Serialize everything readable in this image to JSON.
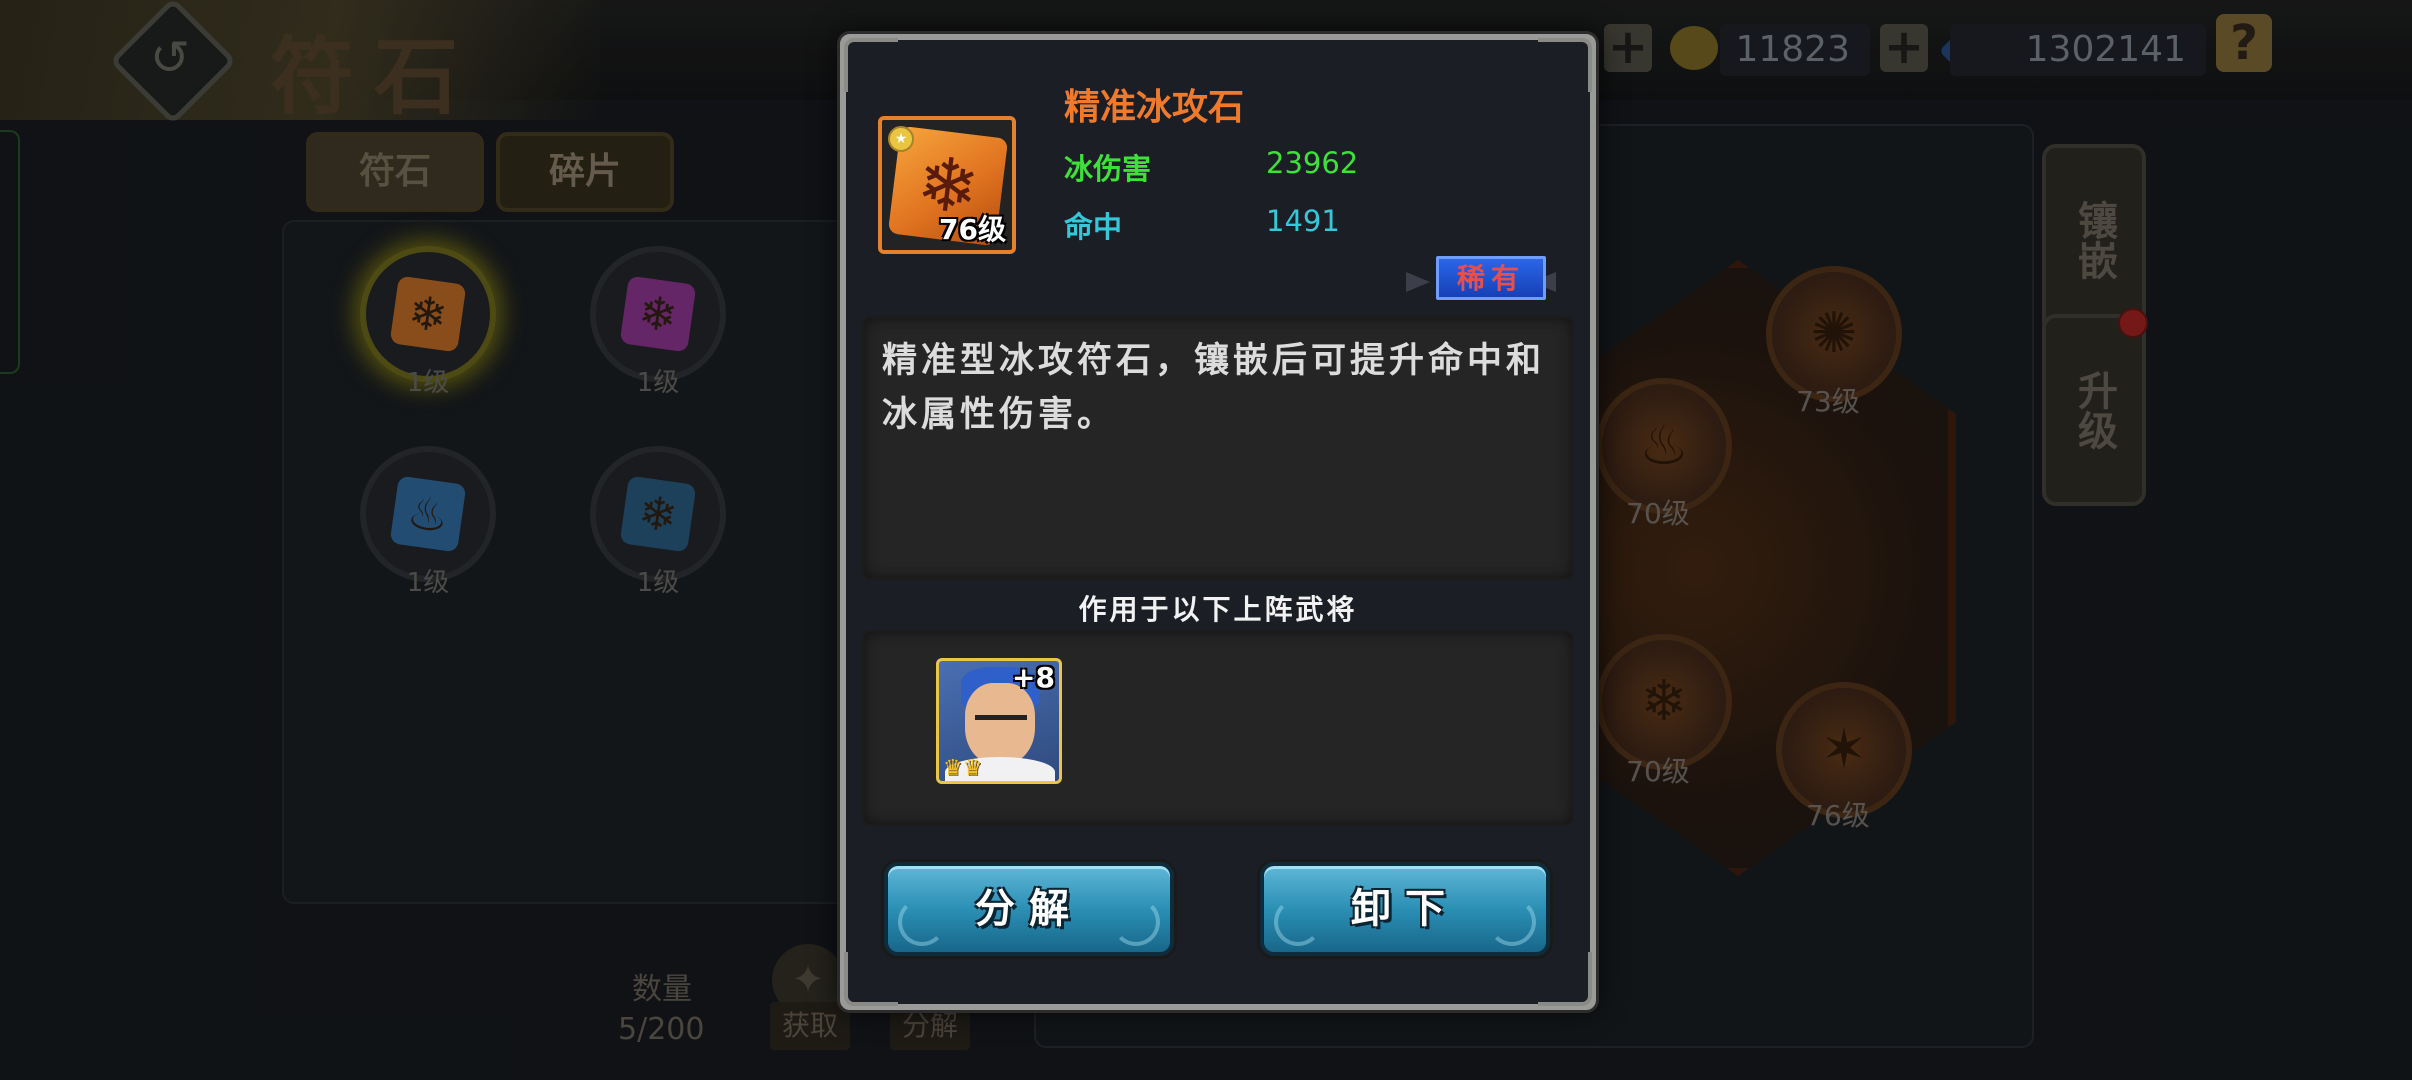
{
  "background": {
    "page_title": "符石",
    "resources": [
      {
        "name": "gold",
        "value": "11823"
      },
      {
        "name": "gem",
        "value": "1302141"
      }
    ],
    "help_label": "?",
    "tabs": [
      {
        "label": "符石",
        "active": true
      },
      {
        "label": "碎片",
        "active": false
      }
    ],
    "inventory": [
      {
        "level": "1级",
        "color": "#c8742a",
        "icon": "snowflake-icon"
      },
      {
        "level": "1级",
        "color": "#9a3d9c",
        "icon": "snowflake-icon"
      },
      {
        "level": "1级",
        "color": "#2f6fa8",
        "icon": "flame-icon"
      },
      {
        "level": "1级",
        "color": "#2a5f8e",
        "icon": "snowflake-icon"
      }
    ],
    "quantity_label": "数量",
    "quantity_value": "5/200",
    "acquire_label": "获取",
    "decompose_label": "分解",
    "socket_levels": [
      "73级",
      "70级",
      "70级",
      "76级"
    ],
    "side_buttons": [
      {
        "label": "镶嵌"
      },
      {
        "label": "升级"
      }
    ]
  },
  "modal": {
    "item": {
      "name": "精准冰攻石",
      "level": "76级",
      "icon": "snowflake-icon",
      "frame_color": "#e5812c"
    },
    "stats": [
      {
        "label": "冰伤害",
        "value": "23962",
        "color": "#3ee03a"
      },
      {
        "label": "命中",
        "value": "1491",
        "color": "#35c8d9"
      }
    ],
    "rarity": "稀有",
    "description": "精准型冰攻符石，镶嵌后可提升命中和冰属性伤害。",
    "heroes_title": "作用于以下上阵武将",
    "heroes": [
      {
        "plus": "+8",
        "crowns": "♛♛"
      }
    ],
    "buttons": {
      "decompose": "分解",
      "unequip": "卸下"
    }
  }
}
